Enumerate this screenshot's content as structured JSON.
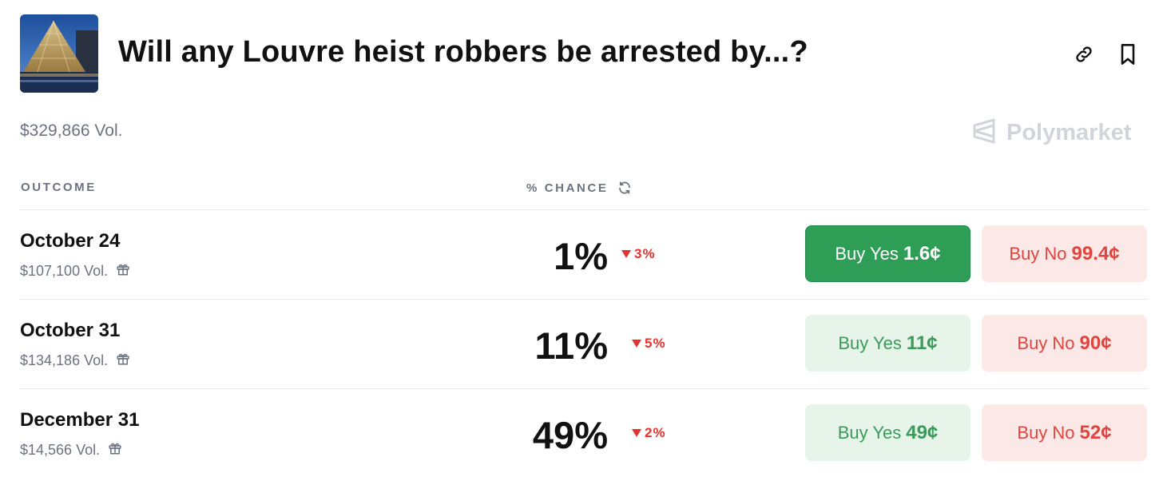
{
  "market": {
    "title": "Will any Louvre heist robbers be arrested by...?",
    "volume": "$329,866 Vol.",
    "brand": "Polymarket"
  },
  "columns": {
    "outcome": "OUTCOME",
    "chance": "% CHANCE"
  },
  "outcomes": [
    {
      "name": "October 24",
      "volume": "$107,100 Vol.",
      "chance": "1%",
      "change": "3%",
      "change_direction": "down",
      "yes_label": "Buy Yes",
      "yes_price": "1.6¢",
      "no_label": "Buy No",
      "no_price": "99.4¢"
    },
    {
      "name": "October 31",
      "volume": "$134,186 Vol.",
      "chance": "11%",
      "change": "5%",
      "change_direction": "down",
      "yes_label": "Buy Yes",
      "yes_price": "11¢",
      "no_label": "Buy No",
      "no_price": "90¢"
    },
    {
      "name": "December 31",
      "volume": "$14,566 Vol.",
      "chance": "49%",
      "change": "2%",
      "change_direction": "down",
      "yes_label": "Buy Yes",
      "yes_price": "49¢",
      "no_label": "Buy No",
      "no_price": "52¢"
    }
  ],
  "colors": {
    "yes_active": "#2e9e56",
    "yes_bg": "#e6f4ea",
    "no_bg": "#fde8e8",
    "no_text": "#e0443e",
    "delta_down": "#e5322d"
  },
  "icons": [
    "link-icon",
    "bookmark-icon",
    "polymarket-logo-icon",
    "refresh-icon",
    "gift-icon",
    "triangle-down-icon"
  ]
}
